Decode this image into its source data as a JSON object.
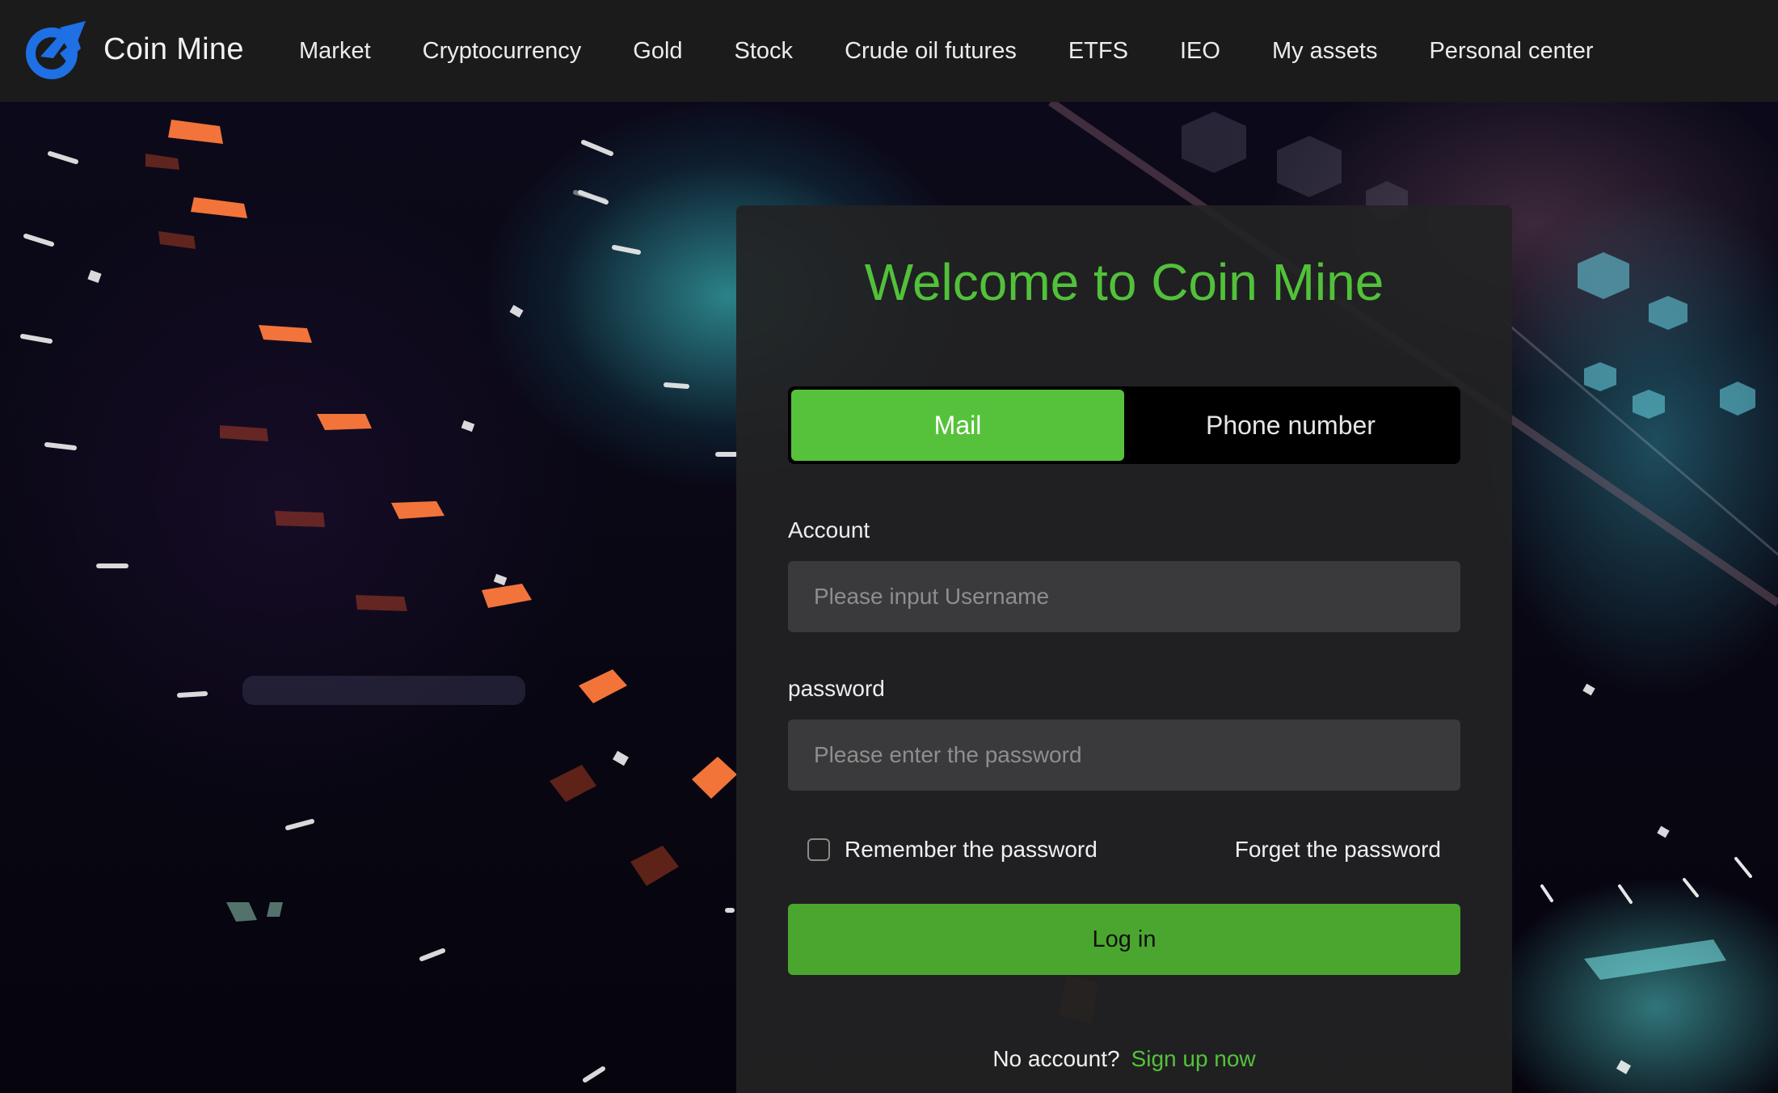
{
  "brand": {
    "name": "Coin Mine",
    "logo_icon": "coin-mine-logo",
    "logo_color": "#1f6fe5"
  },
  "nav": {
    "items": [
      {
        "label": "Market"
      },
      {
        "label": "Cryptocurrency"
      },
      {
        "label": "Gold"
      },
      {
        "label": "Stock"
      },
      {
        "label": "Crude oil futures"
      },
      {
        "label": "ETFS"
      },
      {
        "label": "IEO"
      },
      {
        "label": "My assets"
      },
      {
        "label": "Personal center"
      }
    ]
  },
  "login": {
    "title": "Welcome to Coin Mine",
    "tabs": [
      {
        "label": "Mail",
        "selected": true
      },
      {
        "label": "Phone number",
        "selected": false
      }
    ],
    "account": {
      "label": "Account",
      "placeholder": "Please input Username",
      "value": ""
    },
    "password": {
      "label": "password",
      "placeholder": "Please enter the password",
      "value": ""
    },
    "remember": {
      "label": "Remember the password",
      "checked": false
    },
    "forget_label": "Forget the password",
    "submit_label": "Log in",
    "no_account_text": "No account?",
    "signup_label": "Sign up now"
  },
  "colors": {
    "accent": "#56c23b",
    "login_button": "#4aa62f",
    "topbar": "#1b1b1b",
    "card": "#222224",
    "input": "#3a3a3c"
  }
}
